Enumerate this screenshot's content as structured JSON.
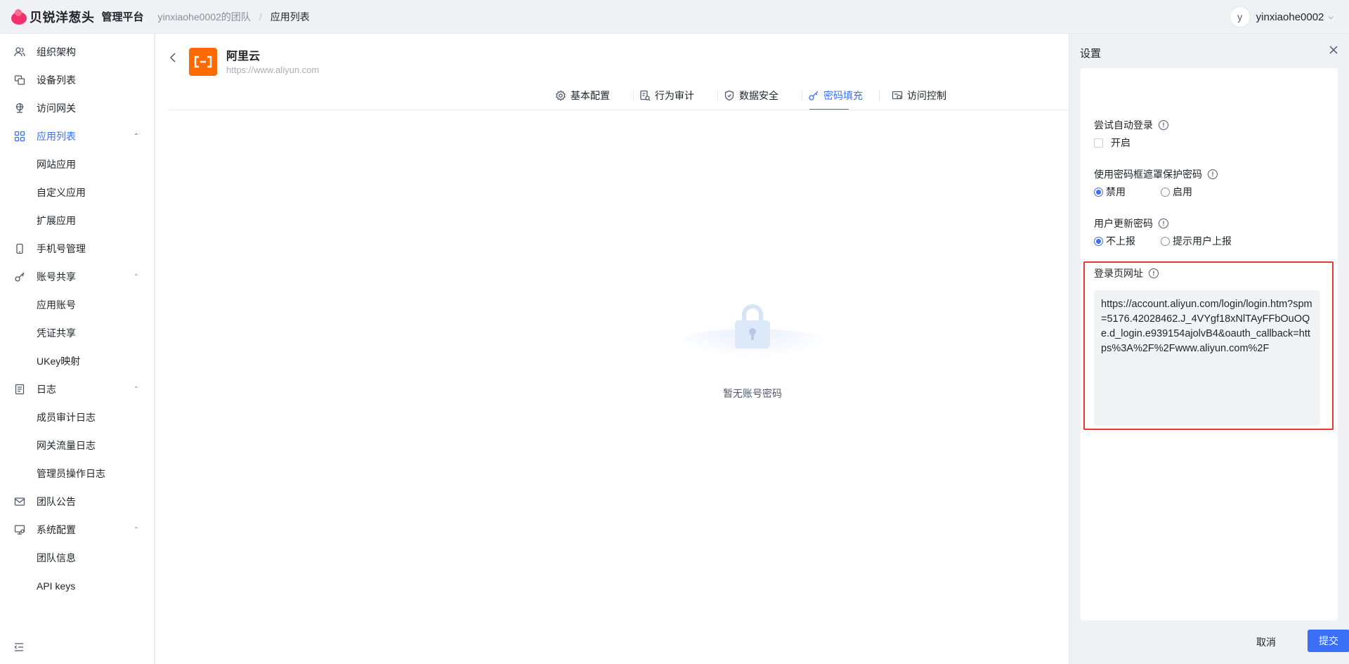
{
  "header": {
    "brand": "贝锐洋葱头",
    "platform": "管理平台",
    "breadcrumb_team": "yinxiaohe0002的团队",
    "breadcrumb_sep": "/",
    "breadcrumb_current": "应用列表",
    "user_initial": "y",
    "user_name": "yinxiaohe0002"
  },
  "sidebar": {
    "items": [
      {
        "label": "组织架构",
        "icon": "org-icon"
      },
      {
        "label": "设备列表",
        "icon": "devices-icon"
      },
      {
        "label": "访问网关",
        "icon": "gateway-icon"
      },
      {
        "label": "应用列表",
        "icon": "apps-icon",
        "active": true
      },
      {
        "label": "网站应用"
      },
      {
        "label": "自定义应用"
      },
      {
        "label": "扩展应用"
      },
      {
        "label": "手机号管理",
        "icon": "phone-icon"
      },
      {
        "label": "账号共享",
        "icon": "key-icon"
      },
      {
        "label": "应用账号"
      },
      {
        "label": "凭证共享"
      },
      {
        "label": "UKey映射"
      },
      {
        "label": "日志",
        "icon": "log-icon"
      },
      {
        "label": "成员审计日志"
      },
      {
        "label": "网关流量日志"
      },
      {
        "label": "管理员操作日志"
      },
      {
        "label": "团队公告",
        "icon": "mail-icon"
      },
      {
        "label": "系统配置",
        "icon": "monitor-icon"
      },
      {
        "label": "团队信息"
      },
      {
        "label": "API keys"
      }
    ]
  },
  "app": {
    "name": "阿里云",
    "url": "https://www.aliyun.com",
    "brand_color": "#ff6a00"
  },
  "tabs": [
    {
      "label": "基本配置",
      "icon": "gear-icon"
    },
    {
      "label": "行为审计",
      "icon": "audit-icon"
    },
    {
      "label": "数据安全",
      "icon": "shield-icon"
    },
    {
      "label": "密码填充",
      "icon": "key-icon",
      "active": true
    },
    {
      "label": "访问控制",
      "icon": "access-icon"
    }
  ],
  "empty": {
    "text": "暂无账号密码"
  },
  "drawer": {
    "title": "设置",
    "auto_login_label": "尝试自动登录",
    "auto_login_option": "开启",
    "mask_label": "使用密码框遮罩保护密码",
    "mask_option_disable": "禁用",
    "mask_option_enable": "启用",
    "update_pwd_label": "用户更新密码",
    "update_option_no": "不上报",
    "update_option_prompt": "提示用户上报",
    "login_url_label": "登录页网址",
    "login_url_value": "https://account.aliyun.com/login/login.htm?spm=5176.42028462.J_4VYgf18xNlTAyFFbOuOQe.d_login.e939154ajolvB4&oauth_callback=https%3A%2F%2Fwww.aliyun.com%2F",
    "cancel_label": "取消",
    "submit_label": "提交"
  },
  "colors": {
    "accent": "#3a6ff7",
    "highlight": "#e8372f"
  }
}
